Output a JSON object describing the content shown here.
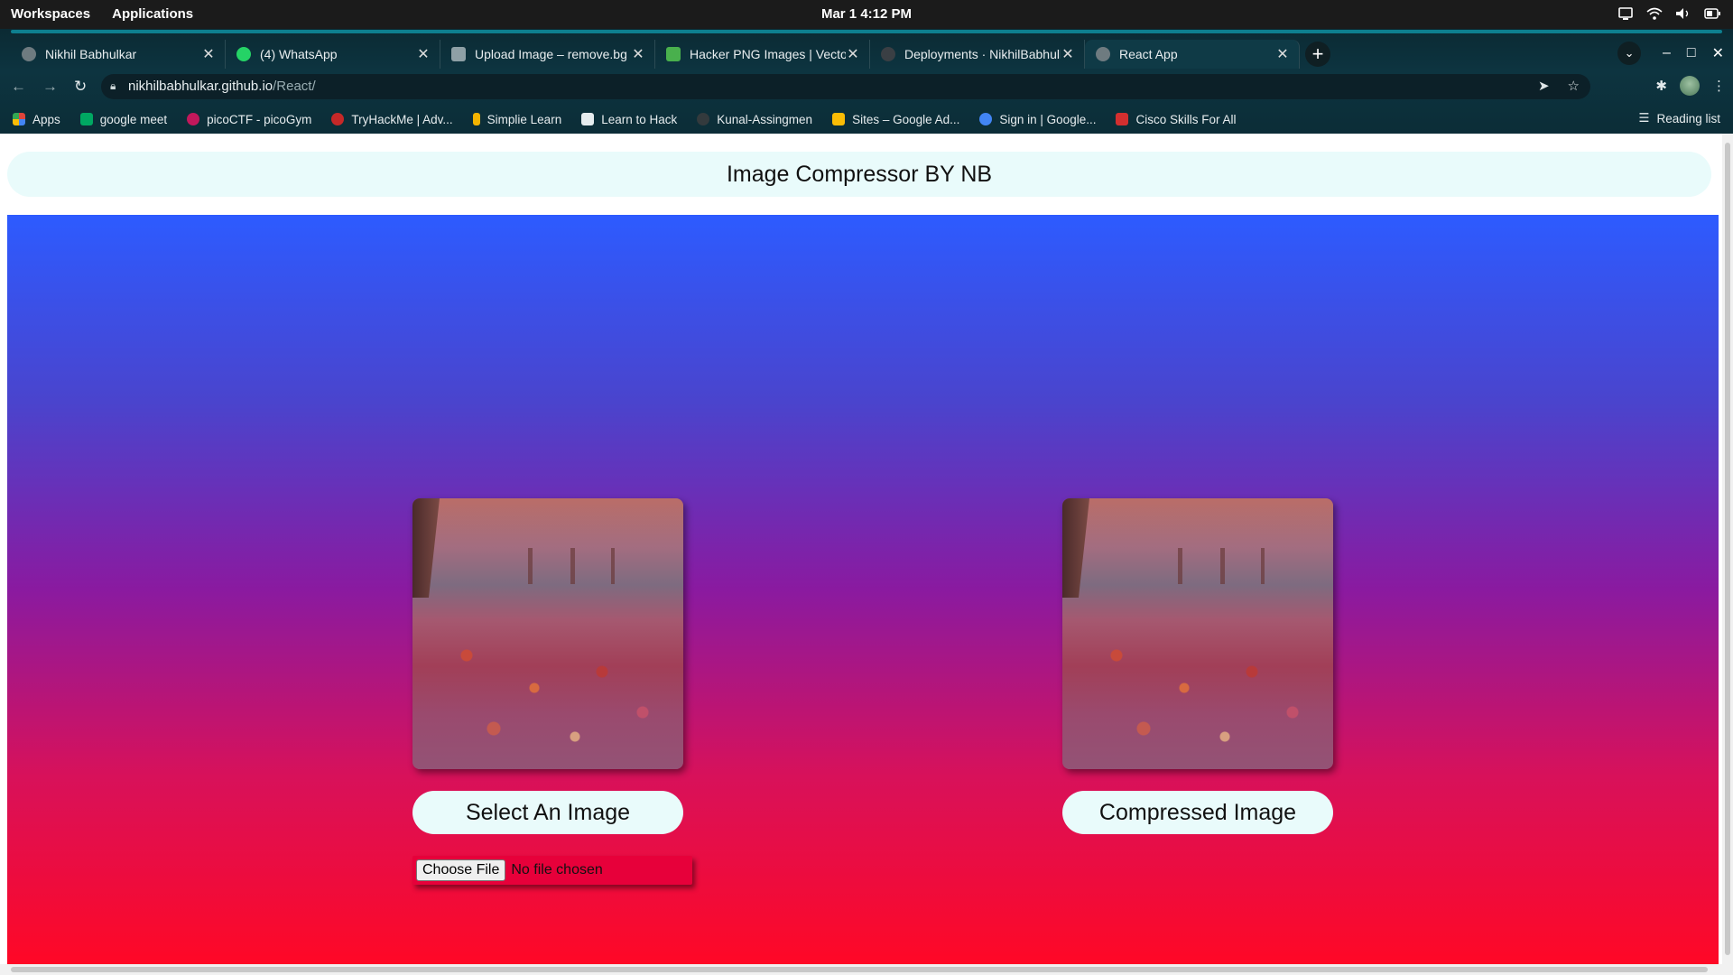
{
  "topbar": {
    "workspaces": "Workspaces",
    "applications": "Applications",
    "clock": "Mar 1   4:12 PM"
  },
  "tabs": [
    {
      "title": "Nikhil Babhulkar",
      "close": "✕",
      "color": "#6e7b80"
    },
    {
      "title": "(4) WhatsApp",
      "close": "✕",
      "color": "#25d366"
    },
    {
      "title": "Upload Image – remove.bg",
      "close": "✕",
      "color": "#8ea0a6"
    },
    {
      "title": "Hacker PNG Images | Vector",
      "close": "✕",
      "color": "#49b04d"
    },
    {
      "title": "Deployments · NikhilBabhulk",
      "close": "✕",
      "color": "#3a3f44"
    },
    {
      "title": "React App",
      "close": "✕",
      "color": "#6e7b80"
    }
  ],
  "new_tab": "+",
  "address": {
    "host": "nikhilbabhulkar.github.io",
    "path": "/React/"
  },
  "bookmarks": [
    {
      "label": "Apps",
      "color": "#e0443a"
    },
    {
      "label": "google meet",
      "color": "#00a862"
    },
    {
      "label": "picoCTF - picoGym",
      "color": "#c2185b"
    },
    {
      "label": "TryHackMe | Adv...",
      "color": "#c62828"
    },
    {
      "label": "Simplie Learn",
      "color": "#f4b400"
    },
    {
      "label": "Learn to Hack",
      "color": "#e6ecee"
    },
    {
      "label": "Kunal-Assingmen",
      "color": "#333a3d"
    },
    {
      "label": "Sites – Google Ad...",
      "color": "#fbbc05"
    },
    {
      "label": "Sign in | Google...",
      "color": "#4285f4"
    },
    {
      "label": "Cisco Skills For All",
      "color": "#d32f2f"
    }
  ],
  "reading_list": "Reading list",
  "page": {
    "header_title": "Image Compressor BY NB",
    "select_label": "Select An Image",
    "compressed_label": "Compressed Image",
    "file_button": "Choose File",
    "file_status": "No file chosen"
  }
}
